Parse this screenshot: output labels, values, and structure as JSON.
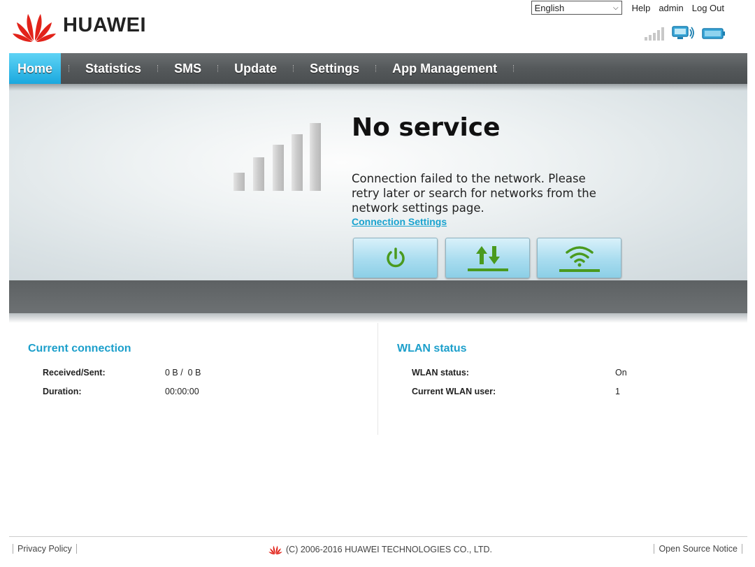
{
  "brand": {
    "name": "HUAWEI",
    "accent": "#e2231a"
  },
  "top_bar": {
    "language": "English",
    "help": "Help",
    "user": "admin",
    "logout": "Log Out"
  },
  "status_icons": [
    "signal-strength-icon",
    "computer-icon",
    "battery-icon"
  ],
  "nav": {
    "items": [
      {
        "label": "Home",
        "active": true
      },
      {
        "label": "Statistics",
        "active": false
      },
      {
        "label": "SMS",
        "active": false
      },
      {
        "label": "Update",
        "active": false
      },
      {
        "label": "Settings",
        "active": false
      },
      {
        "label": "App Management",
        "active": false
      }
    ]
  },
  "hero": {
    "title": "No service",
    "message": "Connection failed to the network. Please retry later or search for networks from the network settings page.",
    "link": "Connection Settings",
    "buttons": [
      "power-icon",
      "data-transfer-icon",
      "wifi-icon"
    ]
  },
  "current_connection": {
    "heading": "Current connection",
    "rows": [
      {
        "label": "Received/Sent:",
        "value": "0 B /  0 B"
      },
      {
        "label": "Duration:",
        "value": "00:00:00"
      }
    ]
  },
  "wlan_status": {
    "heading": "WLAN status",
    "rows": [
      {
        "label": "WLAN status:",
        "value": "On"
      },
      {
        "label": "Current WLAN user:",
        "value": "1"
      }
    ]
  },
  "footer": {
    "privacy": "Privacy Policy",
    "copyright": "(C) 2006-2016 HUAWEI TECHNOLOGIES CO., LTD.",
    "open_source": "Open Source Notice"
  },
  "colors": {
    "nav_active": "#1aa8de",
    "heading": "#1c9fcb",
    "icon_green": "#4a9a1e"
  }
}
